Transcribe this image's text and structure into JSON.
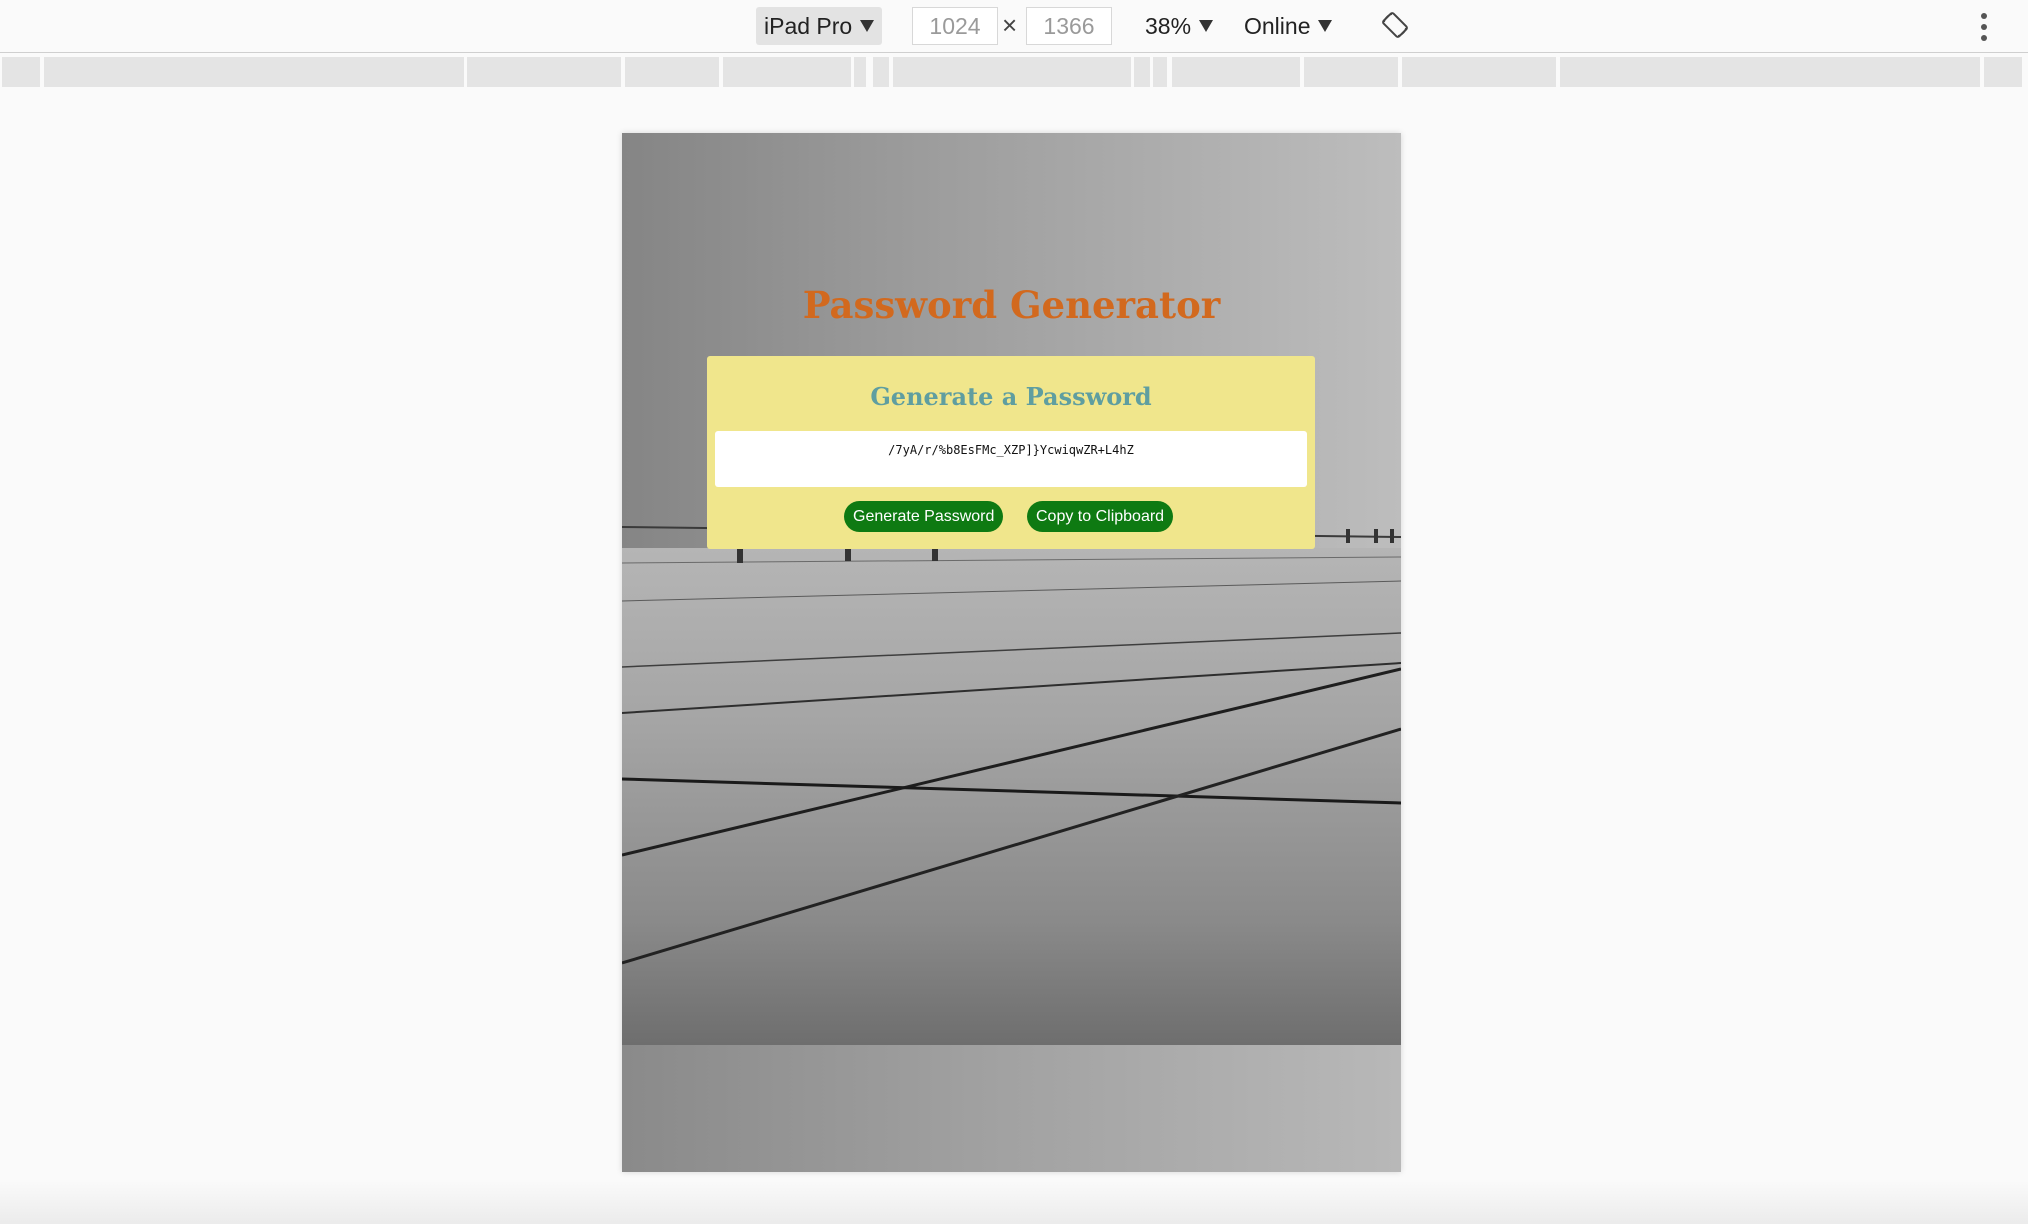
{
  "devtools": {
    "device": "iPad Pro",
    "width": "1024",
    "height": "1366",
    "times": "×",
    "zoom": "38%",
    "network": "Online",
    "icons": {
      "device_caret": "caret-down-icon",
      "rotate": "rotate-icon",
      "more": "more-vertical-icon"
    }
  },
  "app": {
    "title": "Password Generator",
    "card": {
      "heading": "Generate a Password",
      "password": "/7yA/r/%b8EsFMc_XZP]}YcwiqwZR+L4hZ",
      "generate_button": "Generate Password",
      "copy_button": "Copy to Clipboard"
    }
  },
  "colors": {
    "title": "#d2691e",
    "card_background": "#f0e68c",
    "heading": "#5f9ea0",
    "button": "#0e7a12"
  }
}
